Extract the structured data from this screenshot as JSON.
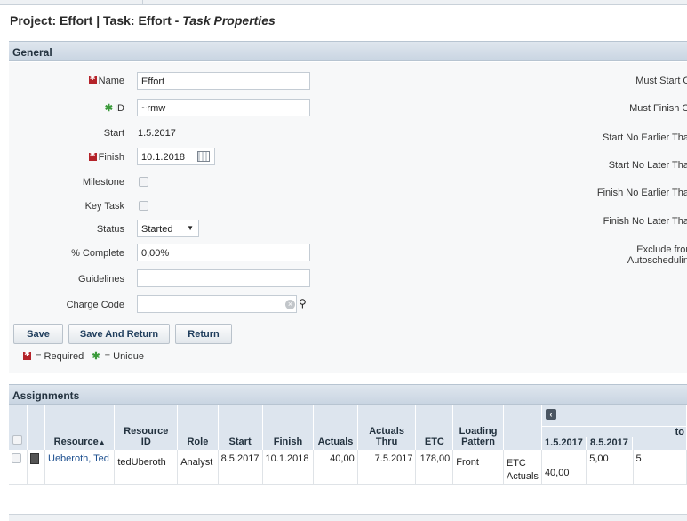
{
  "page": {
    "title_main": "Project: Effort | Task: Effort - ",
    "title_em": "Task Properties"
  },
  "general": {
    "title": "General",
    "name_label": "Name",
    "name_value": "Effort",
    "id_label": "ID",
    "id_value": "~rmw",
    "start_label": "Start",
    "start_value": "1.5.2017",
    "finish_label": "Finish",
    "finish_value": "10.1.2018",
    "milestone_label": "Milestone",
    "keytask_label": "Key Task",
    "status_label": "Status",
    "status_value": "Started",
    "complete_label": "% Complete",
    "complete_value": "0,00%",
    "guidelines_label": "Guidelines",
    "guidelines_value": "",
    "chargecode_label": "Charge Code",
    "chargecode_value": "",
    "right_labels": {
      "must_start": "Must Start O",
      "must_finish": "Must Finish O",
      "start_no_earlier": "Start No Earlier Tha",
      "start_no_later": "Start No Later Tha",
      "finish_no_earlier": "Finish No Earlier Tha",
      "finish_no_later": "Finish No Later Tha",
      "exclude_1": "Exclude fror",
      "exclude_2": "Autoschedulin"
    }
  },
  "buttons": {
    "save": "Save",
    "save_return": "Save And Return",
    "return": "Return"
  },
  "legend": {
    "required": "= Required",
    "unique": "= Unique"
  },
  "assignments": {
    "title": "Assignments",
    "columns": {
      "resource": "Resource",
      "sort_arrow": "▲",
      "resource_id": "Resource ID",
      "role": "Role",
      "start": "Start",
      "finish": "Finish",
      "actuals": "Actuals",
      "actuals_thru": "Actuals Thru",
      "etc": "ETC",
      "loading_pattern": "Loading Pattern",
      "period_group": "to",
      "week1": "1.5.2017",
      "week2": "8.5.2017"
    },
    "row": {
      "resource": "Ueberoth, Ted",
      "resource_id": "tedUberoth",
      "role": "Analyst",
      "start": "8.5.2017",
      "finish": "10.1.2018",
      "actuals": "40,00",
      "actuals_thru": "7.5.2017",
      "etc": "178,00",
      "loading_pattern": "Front",
      "etc_label": "ETC",
      "actuals_label": "Actuals",
      "w1_actuals": "40,00",
      "w2_etc": "5,00",
      "w3_etc": "5"
    }
  }
}
